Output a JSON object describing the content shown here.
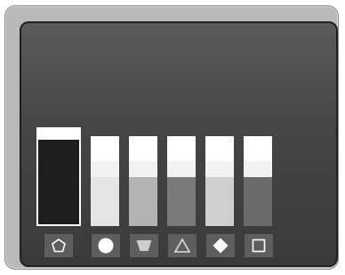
{
  "cartridges": [
    {
      "icon": "pentagon-icon",
      "level": 1.0,
      "fill_color": "#1e1e1e",
      "selected": true
    },
    {
      "icon": "circle-icon",
      "level": 0.75,
      "fill_color": "#e4e4e4",
      "selected": false
    },
    {
      "icon": "trapezoid-icon",
      "level": 0.75,
      "fill_color": "#b3b3b3",
      "selected": false
    },
    {
      "icon": "triangle-icon",
      "level": 0.75,
      "fill_color": "#7a7a7a",
      "selected": false
    },
    {
      "icon": "diamond-icon",
      "level": 0.75,
      "fill_color": "#cfcfcf",
      "selected": false
    },
    {
      "icon": "square-icon",
      "level": 0.75,
      "fill_color": "#6a6a6a",
      "selected": false
    }
  ]
}
